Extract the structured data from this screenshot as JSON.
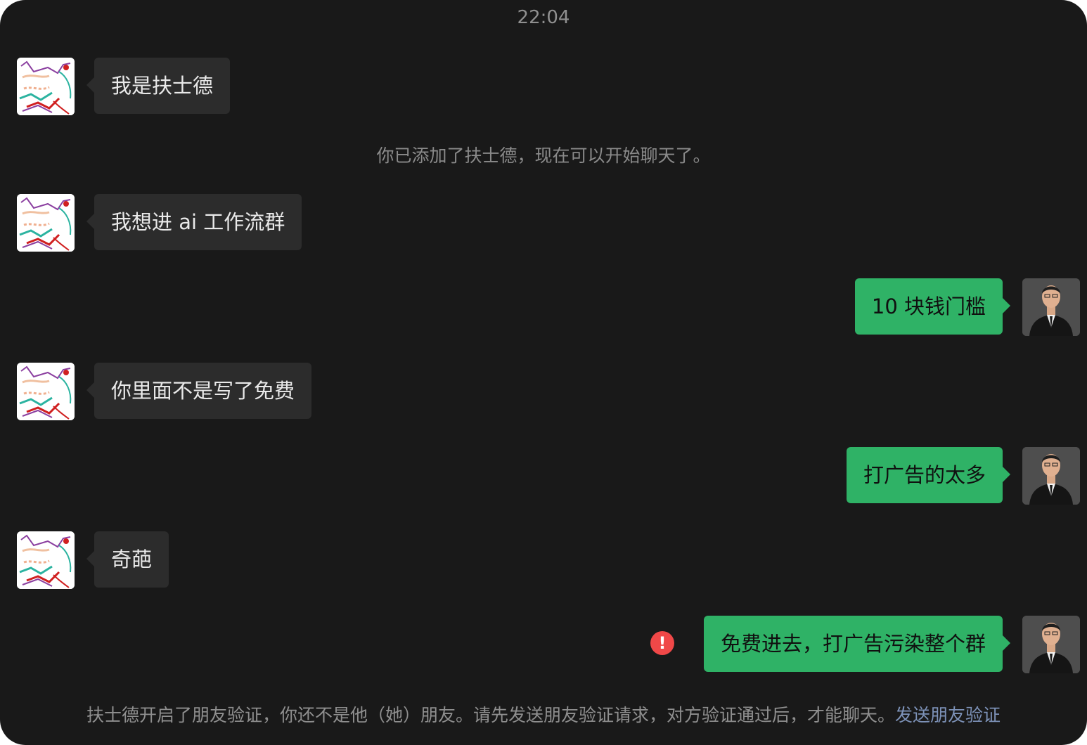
{
  "chat": {
    "timestamp": "22:04",
    "system_note": "你已添加了扶士德，现在可以开始聊天了。",
    "messages": [
      {
        "from": "them",
        "text": "我是扶士德"
      },
      {
        "from": "them",
        "text": "我想进 ai 工作流群"
      },
      {
        "from": "me",
        "text": "10 块钱门槛"
      },
      {
        "from": "them",
        "text": "你里面不是写了免费"
      },
      {
        "from": "me",
        "text": "打广告的太多"
      },
      {
        "from": "them",
        "text": "奇葩"
      },
      {
        "from": "me",
        "text": "免费进去，打广告污染整个群",
        "send_failed": true
      }
    ],
    "error_icon": "!",
    "footer": {
      "notice": "扶士德开启了朋友验证，你还不是他（她）朋友。请先发送朋友验证请求，对方验证通过后，才能聊天。",
      "link_text": "发送朋友验证"
    }
  },
  "colors": {
    "window_bg": "#191919",
    "their_bubble": "#2c2c2c",
    "my_bubble": "#2fb266",
    "error": "#f04848",
    "link": "#7d92b8"
  },
  "icons": {
    "their_avatar": "sketch-drawing-avatar",
    "my_avatar": "person-in-suit-avatar",
    "send_failed": "exclamation-circle-icon"
  }
}
